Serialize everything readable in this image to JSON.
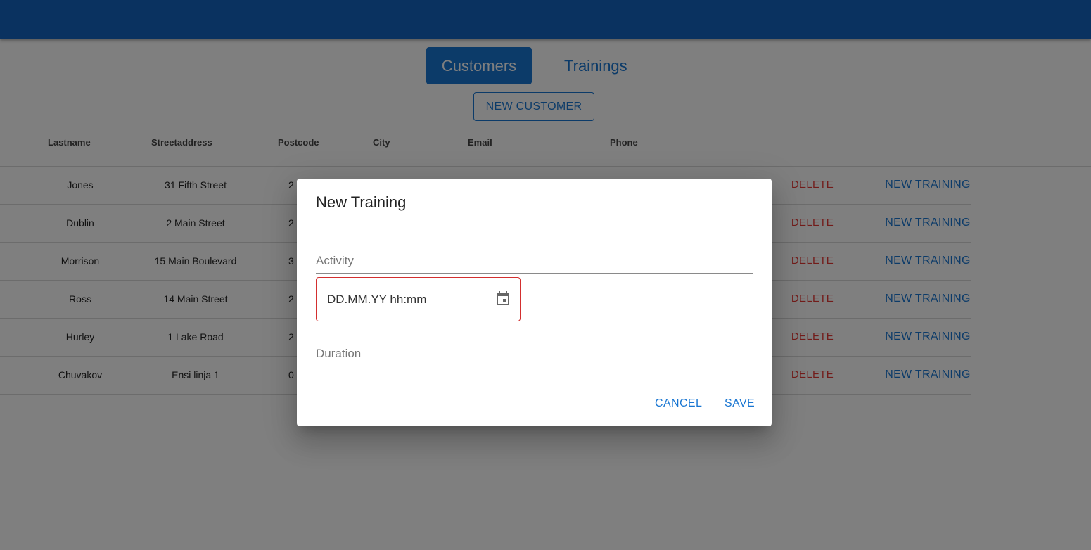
{
  "tabs": [
    {
      "label": "Customers",
      "active": true
    },
    {
      "label": "Trainings",
      "active": false
    }
  ],
  "toolbar": {
    "new_customer_label": "NEW CUSTOMER"
  },
  "grid": {
    "columns": [
      "Lastname",
      "Streetaddress",
      "Postcode",
      "City",
      "Email",
      "Phone"
    ],
    "rows": [
      {
        "lastname": "Jones",
        "street": "31 Fifth Street",
        "postcode": "2",
        "delete": "DELETE",
        "new_training": "NEW TRAINING"
      },
      {
        "lastname": "Dublin",
        "street": "2 Main Street",
        "postcode": "2",
        "delete": "DELETE",
        "new_training": "NEW TRAINING"
      },
      {
        "lastname": "Morrison",
        "street": "15 Main Boulevard",
        "postcode": "3",
        "delete": "DELETE",
        "new_training": "NEW TRAINING"
      },
      {
        "lastname": "Ross",
        "street": "14 Main Street",
        "postcode": "2",
        "delete": "DELETE",
        "new_training": "NEW TRAINING"
      },
      {
        "lastname": "Hurley",
        "street": "1 Lake Road",
        "postcode": "2",
        "delete": "DELETE",
        "new_training": "NEW TRAINING"
      },
      {
        "lastname": "Chuvakov",
        "street": "Ensi linja 1",
        "postcode": "0",
        "delete": "DELETE",
        "new_training": "NEW TRAINING"
      }
    ]
  },
  "dialog": {
    "title": "New Training",
    "activity_label": "Activity",
    "date_placeholder": "DD.MM.YY hh:mm",
    "duration_label": "Duration",
    "cancel_label": "CANCEL",
    "save_label": "SAVE",
    "date_icon": "calendar-icon"
  },
  "colors": {
    "appbar": "#1565c0",
    "primary": "#1976d2",
    "danger": "#e53935",
    "error_border": "#d32f2f"
  }
}
